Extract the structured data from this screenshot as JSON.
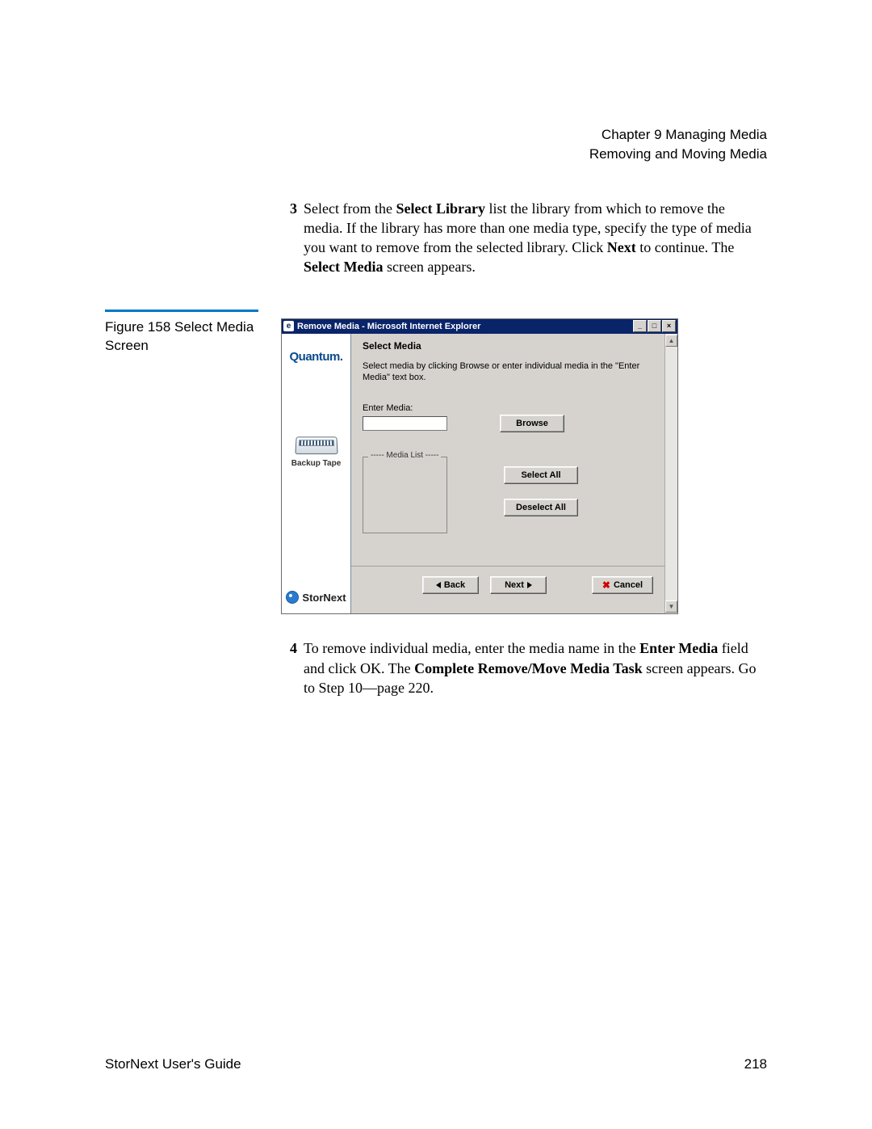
{
  "header": {
    "chapter": "Chapter 9  Managing Media",
    "section": "Removing and Moving Media"
  },
  "step3": {
    "num": "3",
    "t1": "Select from the ",
    "b1": "Select Library",
    "t2": " list the library from which to remove the media. If the library has more than one media type, specify the type of media you want to remove from the selected library. Click ",
    "b2": "Next",
    "t3": " to continue. The ",
    "b3": "Select Media",
    "t4": " screen appears."
  },
  "caption": "Figure 158  Select Media Screen",
  "window": {
    "title": "Remove Media - Microsoft Internet Explorer",
    "brand": "Quantum.",
    "tape_label": "Backup Tape",
    "product": "StorNext",
    "panel_title": "Select Media",
    "instruction": "Select media by clicking Browse or enter individual media in the \"Enter Media\" text box.",
    "enter_media_label": "Enter Media:",
    "browse": "Browse",
    "media_list_legend": "----- Media List -----",
    "select_all": "Select All",
    "deselect_all": "Deselect All",
    "back": "Back",
    "next": "Next",
    "cancel": "Cancel"
  },
  "step4": {
    "num": "4",
    "t1": "To remove individual media, enter the media name in the ",
    "b1": "Enter Media",
    "t2": " field and click OK. The ",
    "b2": "Complete Remove/Move Media Task",
    "t3": " screen appears. Go to Step 10—page 220."
  },
  "footer": {
    "left": "StorNext User's Guide",
    "right": "218"
  }
}
